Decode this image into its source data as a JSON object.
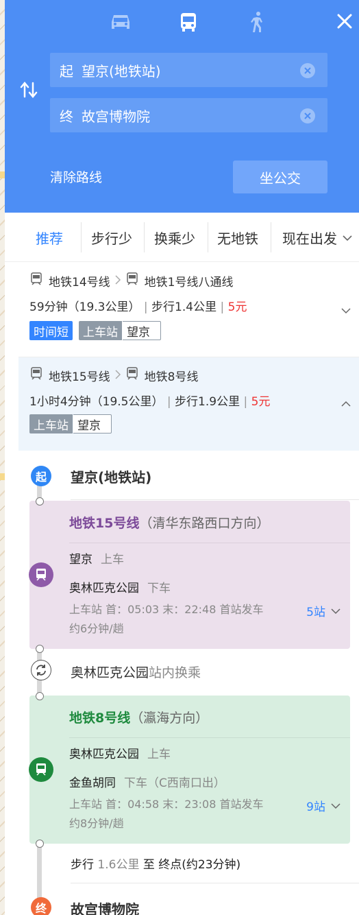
{
  "colors": {
    "header": "#4d8ef5",
    "accent": "#3385ff",
    "price": "#e33333",
    "line15": "#8e5aa8",
    "line8": "#2a9a4a",
    "start_pin": "#2f87f5",
    "end_pin": "#f06a3a"
  },
  "header": {
    "modes": [
      {
        "name": "car-icon",
        "active": false
      },
      {
        "name": "bus-icon",
        "active": true
      },
      {
        "name": "walk-icon",
        "active": false
      }
    ],
    "start": {
      "tag": "起",
      "value": "望京(地铁站)"
    },
    "end": {
      "tag": "终",
      "value": "故宫博物院"
    },
    "clear_route": "清除路线",
    "take_bus": "坐公交"
  },
  "tabs": [
    "推荐",
    "步行少",
    "换乘少",
    "无地铁"
  ],
  "depart": "现在出发",
  "plans": [
    {
      "lines": [
        "地铁14号线",
        "地铁1号线八通线"
      ],
      "time": "59分钟",
      "distance": "（19.3公里）",
      "walk": "步行1.4公里",
      "price": "5元",
      "badge_fast": "时间短",
      "badge_station": "上车站",
      "station": "望京"
    },
    {
      "lines": [
        "地铁15号线",
        "地铁8号线"
      ],
      "time": "1小时4分钟",
      "distance": "（19.5公里）",
      "walk": "步行1.9公里",
      "price": "5元",
      "badge_station": "上车站",
      "station": "望京"
    }
  ],
  "detail": {
    "start_tag": "起",
    "start_place": "望京(地铁站)",
    "seg1": {
      "line": "地铁15号线",
      "direction": "（清华东路西口方向）",
      "board": "望京",
      "board_act": "上车",
      "alight": "奥林匹克公园",
      "alight_act": "下车",
      "meta1": "上车站 首：05:03  末：22:48  首站发车",
      "meta2": "约6分钟/趟",
      "stops": "5站"
    },
    "transfer": {
      "station": "奥林匹克公园",
      "note": "站内换乘"
    },
    "seg2": {
      "line": "地铁8号线",
      "direction": "（瀛海方向）",
      "board": "奥林匹克公园",
      "board_act": "上车",
      "alight": "金鱼胡同",
      "alight_act": "下车（C西南口出）",
      "meta1": "上车站 首：04:58  末：23:08  首站发车",
      "meta2": "约8分钟/趟",
      "stops": "9站"
    },
    "walk": {
      "label": "步行",
      "dist": "1.6公里",
      "to": "至",
      "dest": "终点(约23分钟)"
    },
    "end_tag": "终",
    "end_place": "故宫博物院"
  }
}
